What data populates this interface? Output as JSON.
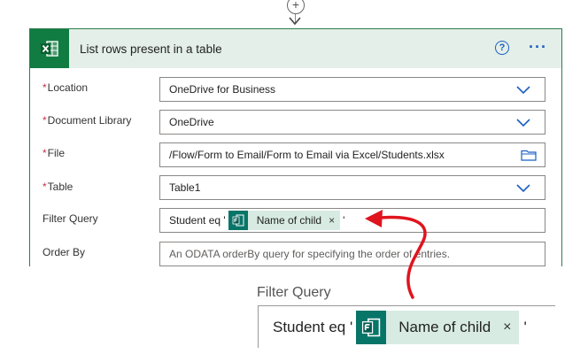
{
  "add_step_label": "+",
  "card": {
    "title": "List rows present in a table",
    "help_label": "?",
    "more_label": "···"
  },
  "fields": {
    "location": {
      "label": "Location",
      "value": "OneDrive for Business"
    },
    "library": {
      "label": "Document Library",
      "value": "OneDrive"
    },
    "file": {
      "label": "File",
      "value": "/Flow/Form to Email/Form to Email via Excel/Students.xlsx"
    },
    "table": {
      "label": "Table",
      "value": "Table1"
    },
    "filter": {
      "label": "Filter Query",
      "prefix": "Student eq '",
      "token": "Name of child",
      "token_close": "×",
      "suffix": "'"
    },
    "order": {
      "label": "Order By",
      "placeholder": "An ODATA orderBy query for specifying the order of entries."
    }
  },
  "required_mark": "*",
  "zoom": {
    "label": "Filter Query",
    "prefix": "Student eq '",
    "token": "Name of child",
    "token_close": "×",
    "suffix": "'"
  },
  "colors": {
    "excel_green": "#107c41",
    "forms_teal": "#077568",
    "header_bg": "#e3efe8",
    "accent_blue": "#1a5fc4",
    "annotation_red": "#e0141e"
  },
  "icons": {
    "app": "excel-icon",
    "token": "forms-icon",
    "help": "help-icon",
    "more": "more-icon",
    "dropdown": "chevron-down-icon",
    "file_picker": "folder-icon"
  }
}
